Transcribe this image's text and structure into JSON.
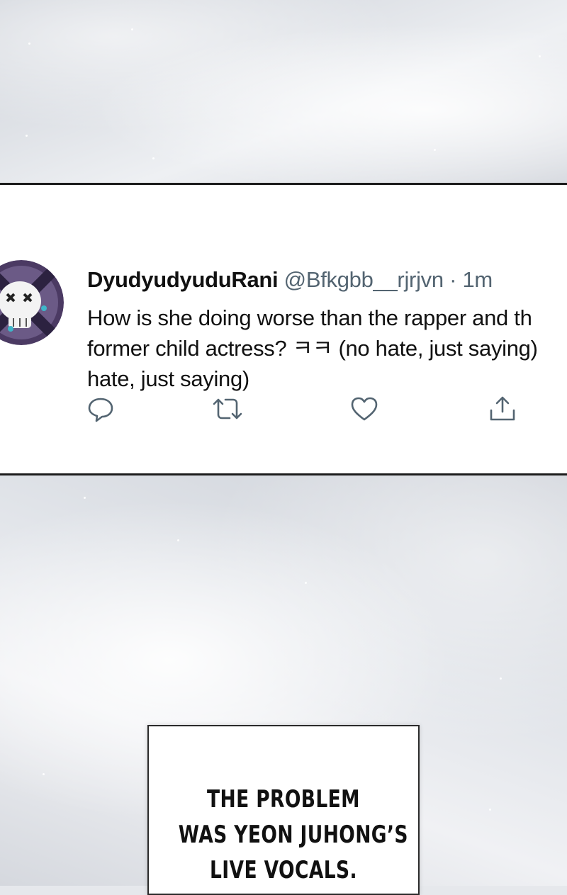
{
  "tweet": {
    "display_name": "DyudyudyuduRani",
    "handle": "@Bfkgbb__rjrjvn",
    "separator": "·",
    "time": "1m",
    "text_lines": [
      "How is she doing worse than the rapper and th",
      "former child actress? ㅋㅋ (no hate, just saying)",
      "hate, just saying)"
    ],
    "actions": [
      "reply-icon",
      "retweet-icon",
      "like-icon",
      "share-icon"
    ],
    "icon_color": "#536471"
  },
  "caption": {
    "lines": [
      "THE PROBLEM",
      "WAS YEON JUHONG’S",
      "LIVE VOCALS."
    ]
  },
  "colors": {
    "panel_border": "#1c1c1c",
    "avatar_purple": "#4b3a63",
    "avatar_accent": "#3fb6c9"
  }
}
